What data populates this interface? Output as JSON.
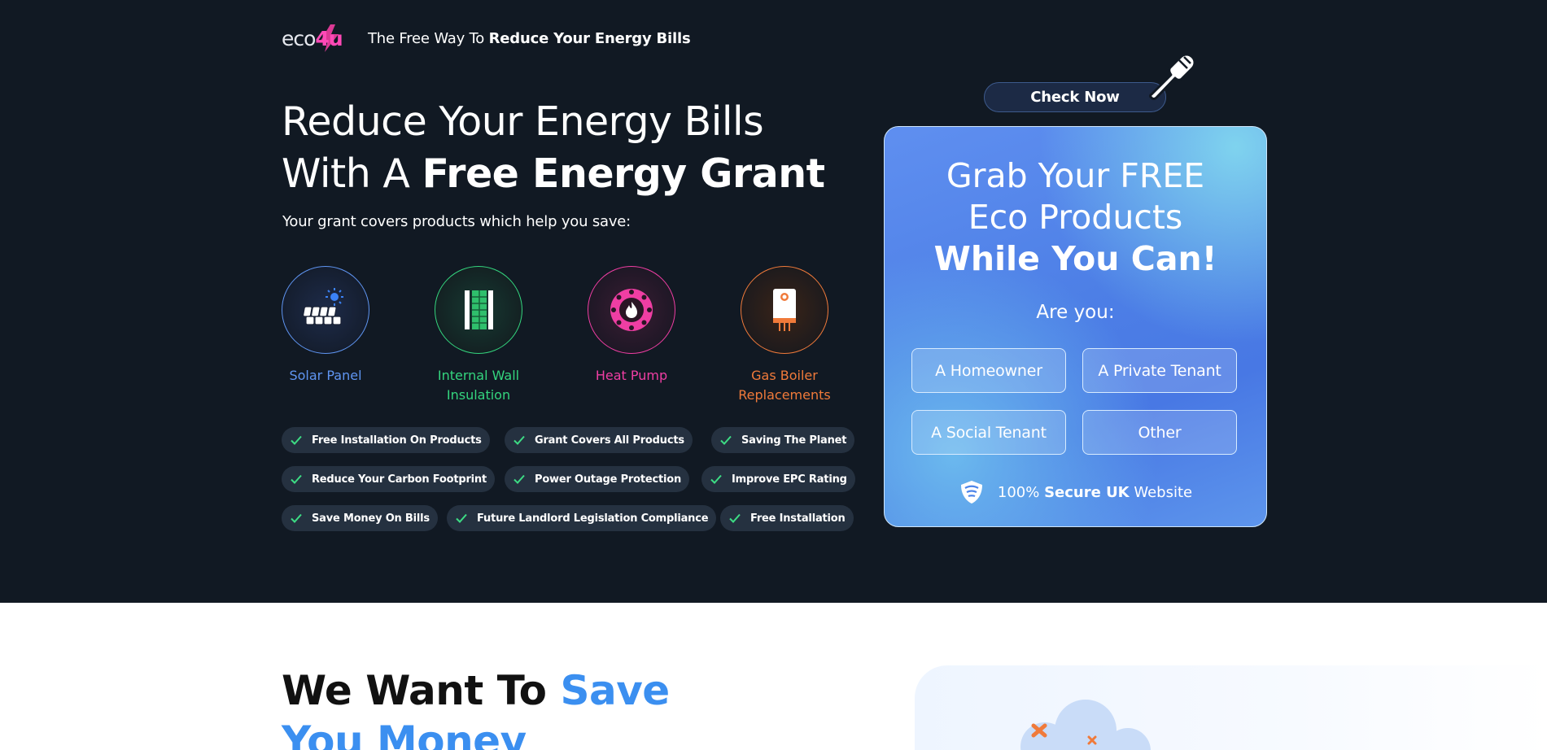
{
  "header": {
    "logo_text_a": "eco",
    "logo_text_b": "4u",
    "tagline_plain": "The Free Way To ",
    "tagline_bold": "Reduce Your Energy Bills"
  },
  "hero": {
    "title_line1": "Reduce Your Energy Bills",
    "title_line2_plain": "With A ",
    "title_line2_bold": "Free Energy Grant",
    "subtitle": "Your grant covers products which help you save:",
    "products": [
      {
        "label": "Solar Panel",
        "color": "#5f95f2",
        "icon": "solar-panel-icon"
      },
      {
        "label": "Internal Wall Insulation",
        "color": "#34d57e",
        "icon": "wall-insulation-icon"
      },
      {
        "label": "Heat Pump",
        "color": "#ef3ea3",
        "icon": "heat-pump-icon"
      },
      {
        "label": "Gas Boiler Replacements",
        "color": "#f07a3a",
        "icon": "gas-boiler-icon"
      }
    ],
    "benefits": [
      [
        "Free Installation On Products",
        "Grant Covers All Products",
        "Saving The Planet"
      ],
      [
        "Reduce Your Carbon Footprint",
        "Power Outage Protection",
        "Improve EPC Rating"
      ],
      [
        "Save Money On Bills",
        "Future Landlord Legislation Compliance",
        "Free Installation"
      ]
    ],
    "check_color": "#3ddc84"
  },
  "cta": {
    "check_now": "Check Now",
    "card_title_line1": "Grab Your FREE",
    "card_title_line2": "Eco Products",
    "card_title_line3": "While You Can!",
    "question": "Are you:",
    "options": [
      "A Homeowner",
      "A Private Tenant",
      "A Social Tenant",
      "Other"
    ],
    "secure_plain_a": "100% ",
    "secure_bold": "Secure UK",
    "secure_plain_b": " Website"
  },
  "section2": {
    "title_plain": "We Want To ",
    "title_blue_1": "Save",
    "title_blue_2": "You Money"
  }
}
